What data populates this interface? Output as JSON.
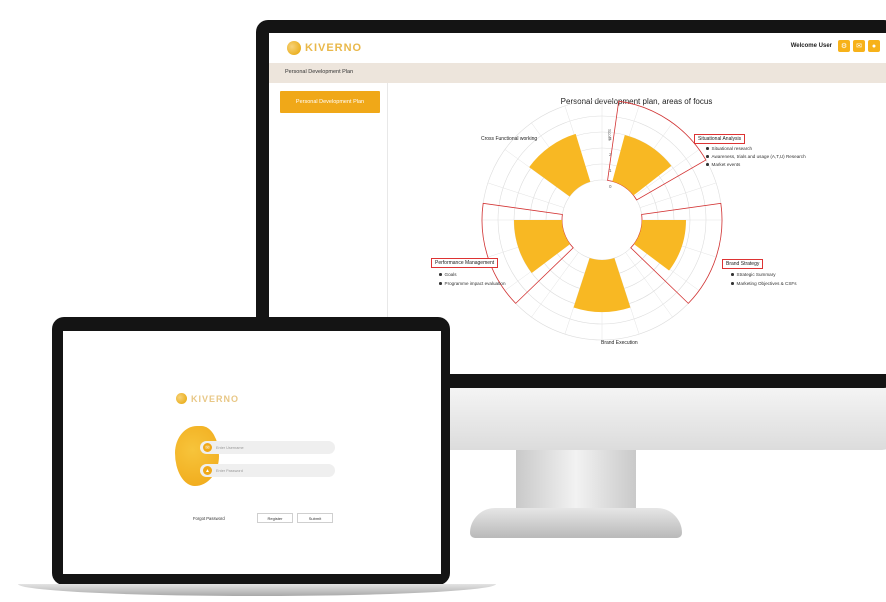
{
  "desktop": {
    "header": {
      "logo_text": "KIVERNO",
      "welcome": "Welcome  User",
      "icons": [
        "settings-icon",
        "mail-icon",
        "user-icon"
      ]
    },
    "breadcrumb": "Personal Development Plan",
    "sidebar": {
      "active_item": "Personal Development Plan"
    },
    "chart": {
      "title": "Personal development plan, areas of focus",
      "ticks": [
        "0",
        "1",
        "2",
        "3"
      ],
      "tick_axis_label": "Score",
      "segments": [
        {
          "label": "Situational Analysis",
          "bullets": [
            "Situational research",
            "Awareness, trials and usage (A,T,U) Research",
            "Market events"
          ]
        },
        {
          "label": "Brand Strategy",
          "bullets": [
            "Strategic Summary",
            "Marketing Objectives & CSFs"
          ]
        },
        {
          "label": "Brand Execution",
          "bullets": []
        },
        {
          "label": "Performance Management",
          "bullets": [
            "Goals",
            "Programme impact evaluation"
          ]
        },
        {
          "label": "Cross Functional working",
          "bullets": []
        }
      ],
      "accent_color": "#f8b823",
      "highlight_color": "#d33333"
    }
  },
  "laptop": {
    "logo_text": "KIVERNO",
    "username_placeholder": "Enter Username",
    "password_placeholder": "Enter Password",
    "forgot_label": "Forgot Password",
    "register_label": "Register",
    "submit_label": "Submit"
  }
}
